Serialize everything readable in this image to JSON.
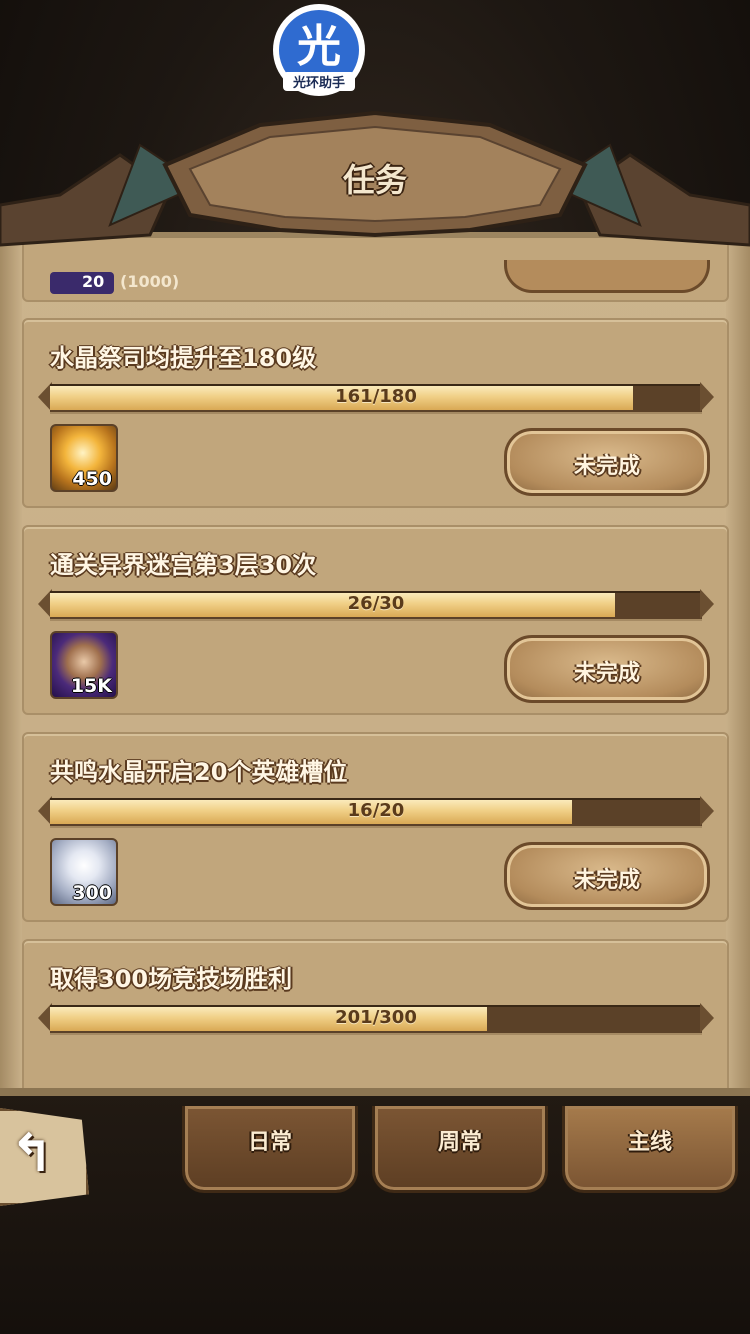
{
  "watermark": {
    "char": "光",
    "text": "光环助手"
  },
  "header": {
    "title": "任务"
  },
  "partial_top": {
    "count": "20",
    "extra": "(1000)"
  },
  "quests": [
    {
      "title": "水晶祭司均提升至180级",
      "progress_text": "161/180",
      "progress": 0.894,
      "reward": {
        "icon": "gold-orb-icon",
        "count": "450"
      },
      "status_label": "未完成"
    },
    {
      "title": "通关异界迷宫第3层30次",
      "progress_text": "26/30",
      "progress": 0.867,
      "reward": {
        "icon": "labyrinth-coin-icon",
        "count": "15K"
      },
      "status_label": "未完成"
    },
    {
      "title": "共鸣水晶开启20个英雄槽位",
      "progress_text": "16/20",
      "progress": 0.8,
      "reward": {
        "icon": "diamond-icon",
        "count": "300"
      },
      "status_label": "未完成"
    },
    {
      "title": "取得300场竞技场胜利",
      "progress_text": "201/300",
      "progress": 0.67
    }
  ],
  "tabs": [
    {
      "label": "日常"
    },
    {
      "label": "周常"
    },
    {
      "label": "主线",
      "active": true
    }
  ],
  "colors": {
    "parchment": "#c9b089",
    "bar_fill": "#f0cf86",
    "bar_track": "#5b4128",
    "tab_active": "#a67b4c"
  }
}
